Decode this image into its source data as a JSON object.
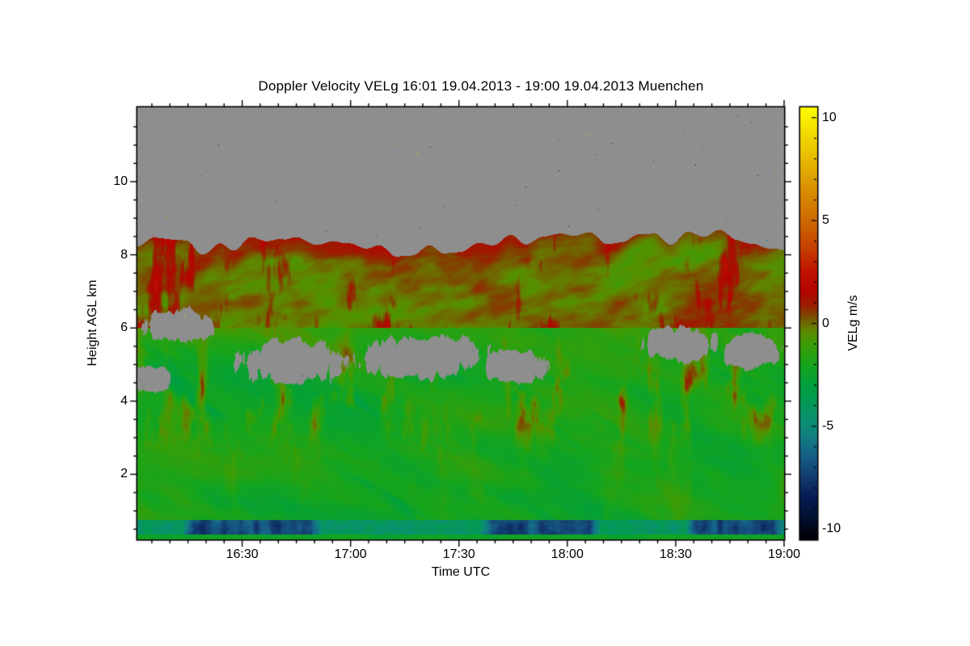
{
  "window": {
    "background": "#ffffff"
  },
  "chart_data": {
    "type": "heatmap",
    "title": "Doppler Velocity VELg   16:01 19.04.2013 - 19:00 19.04.2013 Muenchen",
    "xlabel": "Time UTC",
    "ylabel": "Height AGL km",
    "x_axis": {
      "start": "16:01",
      "end": "19:00",
      "duration_min": 179,
      "ticks": [
        {
          "label": "16:30",
          "min": 29
        },
        {
          "label": "17:00",
          "min": 59
        },
        {
          "label": "17:30",
          "min": 89
        },
        {
          "label": "18:00",
          "min": 119
        },
        {
          "label": "18:30",
          "min": 149
        },
        {
          "label": "19:00",
          "min": 179
        }
      ],
      "minor_step_min": 5
    },
    "y_axis": {
      "range_km": [
        0.22,
        12.03
      ],
      "ticks": [
        2,
        4,
        6,
        8,
        10
      ],
      "minor_step_km": 0.5
    },
    "colorbar": {
      "label": "VELg m/s",
      "range": [
        -10.5,
        10.5
      ],
      "ticks": [
        10,
        5,
        0,
        -5,
        -10
      ],
      "minor_step": 1,
      "stops": [
        [
          -10.5,
          "#000004"
        ],
        [
          -9.5,
          "#00102e"
        ],
        [
          -8.5,
          "#061b52"
        ],
        [
          -7.5,
          "#123a6e"
        ],
        [
          -6.5,
          "#175d86"
        ],
        [
          -5.5,
          "#117e82"
        ],
        [
          -4.8,
          "#0b8f74"
        ],
        [
          -4.0,
          "#049858"
        ],
        [
          -3.0,
          "#00a03e"
        ],
        [
          -2.0,
          "#16a41c"
        ],
        [
          -1.0,
          "#3d9d06"
        ],
        [
          -0.4,
          "#5c8b00"
        ],
        [
          0.0,
          "#6e6a00"
        ],
        [
          0.4,
          "#7e4600"
        ],
        [
          0.9,
          "#9c1c00"
        ],
        [
          1.6,
          "#b40500"
        ],
        [
          2.5,
          "#bf1200"
        ],
        [
          3.5,
          "#c53a00"
        ],
        [
          5.0,
          "#cd6a00"
        ],
        [
          6.5,
          "#d98f00"
        ],
        [
          8.0,
          "#e7bb00"
        ],
        [
          9.3,
          "#f2dc00"
        ],
        [
          10.5,
          "#fdfd00"
        ]
      ]
    },
    "no_data_color": "#8e8e8e",
    "frame_color": "#000000",
    "features": {
      "cloud_top_km": {
        "base": 8.3,
        "amp": 0.45,
        "fuzz_km": 1.3
      },
      "upper_cloud_layer": {
        "bottom_km": 6.0,
        "vel_mean_ms": -0.2,
        "vel_spread_ms": 1.5,
        "warm_streaks": true
      },
      "lower_layer": {
        "top_km": 6.0,
        "vel_mean_ms": -2.0,
        "vel_spread_ms": 1.3,
        "teal_streaks": true,
        "warm_streak_center_km": 4.2
      },
      "grey_blob_format": "[t_center_min, h_center_km, rt_min, rh_km]",
      "grey_blobs": [
        [
          4,
          4.6,
          8,
          0.45
        ],
        [
          11,
          6.05,
          13,
          0.6
        ],
        [
          44,
          5.05,
          21,
          0.8
        ],
        [
          80,
          5.2,
          22,
          0.75
        ],
        [
          105,
          4.95,
          13,
          0.6
        ],
        [
          150,
          5.55,
          14,
          0.6
        ],
        [
          170,
          5.35,
          11,
          0.6
        ]
      ],
      "surface_band": {
        "top_km": 0.76,
        "bottom_km": 0.35,
        "base_vel_ms": -4.2,
        "dark_vel_ms": -7.6,
        "dark_segments_min": [
          [
            13,
            51
          ],
          [
            95,
            128
          ],
          [
            152,
            179
          ]
        ]
      },
      "ground_strip": {
        "below_km": 0.35,
        "vel_ms": -2.3
      },
      "speckle_density": 0.00045
    }
  }
}
